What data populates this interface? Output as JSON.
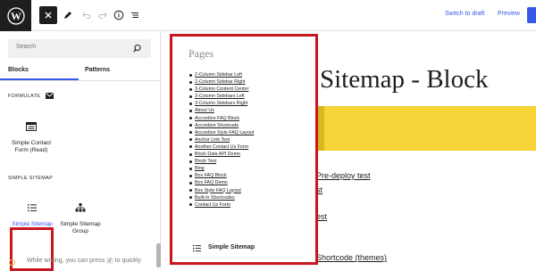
{
  "toolbar": {
    "switch_to_draft": "Switch to draft",
    "preview": "Preview",
    "accent_color": "#3858e9",
    "icons": [
      "wordpress-logo",
      "close-icon",
      "pen-icon",
      "undo-icon",
      "redo-icon",
      "info-icon",
      "list-view-icon"
    ]
  },
  "sidebar": {
    "search_placeholder": "Search",
    "tabs": [
      {
        "label": "Blocks",
        "active": true
      },
      {
        "label": "Patterns",
        "active": false
      }
    ],
    "categories": [
      {
        "title": "FORMULATE",
        "blocks": [
          {
            "label": "Simple Contact Form (Read)"
          }
        ]
      },
      {
        "title": "SIMPLE SITEMAP",
        "blocks": [
          {
            "label": "Simple Sitemap"
          },
          {
            "label": "Simple Sitemap Group"
          }
        ]
      }
    ],
    "hint": {
      "before": "While writing, you can press",
      "key": "/",
      "after": "to quickly"
    }
  },
  "preview_popup": {
    "title": "Pages",
    "pages": [
      "2-Column Sidebar Left",
      "2-Column Sidebar Right",
      "3-Column Content Center",
      "3-Column Sidebars Left",
      "3-Column Sidebars Right",
      "About Us",
      "Accordion FAQ Block",
      "Accordion Shortcode",
      "Accordion Style FAQ Layout",
      "Anchor Link Test",
      "Another Contact Us Form",
      "Block Data API Demo",
      "Block Test",
      "Blog",
      "Box FAQ Block",
      "Box FAQ Demo",
      "Box Style FAQ Layout",
      "Built-In Shortcodes",
      "Contact Us Form"
    ],
    "footer_label": "Simple Sitemap"
  },
  "editor": {
    "title": "Sitemap - Block",
    "content_lines": [
      "Pre-deploy test",
      "st",
      "est",
      "Shortcode (themes)"
    ]
  }
}
